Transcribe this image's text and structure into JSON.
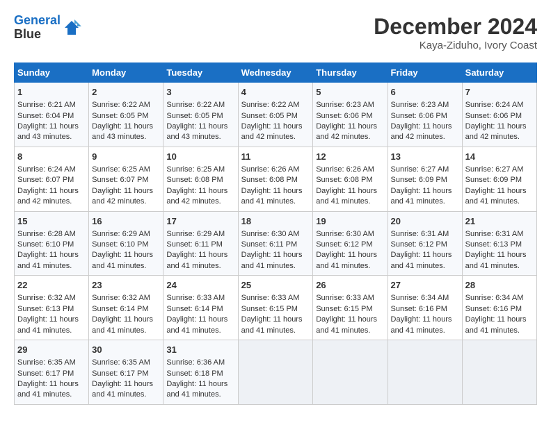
{
  "header": {
    "logo_line1": "General",
    "logo_line2": "Blue",
    "title": "December 2024",
    "subtitle": "Kaya-Ziduho, Ivory Coast"
  },
  "days_of_week": [
    "Sunday",
    "Monday",
    "Tuesday",
    "Wednesday",
    "Thursday",
    "Friday",
    "Saturday"
  ],
  "weeks": [
    [
      {
        "day": "1",
        "lines": [
          "Sunrise: 6:21 AM",
          "Sunset: 6:04 PM",
          "Daylight: 11 hours",
          "and 43 minutes."
        ]
      },
      {
        "day": "2",
        "lines": [
          "Sunrise: 6:22 AM",
          "Sunset: 6:05 PM",
          "Daylight: 11 hours",
          "and 43 minutes."
        ]
      },
      {
        "day": "3",
        "lines": [
          "Sunrise: 6:22 AM",
          "Sunset: 6:05 PM",
          "Daylight: 11 hours",
          "and 43 minutes."
        ]
      },
      {
        "day": "4",
        "lines": [
          "Sunrise: 6:22 AM",
          "Sunset: 6:05 PM",
          "Daylight: 11 hours",
          "and 42 minutes."
        ]
      },
      {
        "day": "5",
        "lines": [
          "Sunrise: 6:23 AM",
          "Sunset: 6:06 PM",
          "Daylight: 11 hours",
          "and 42 minutes."
        ]
      },
      {
        "day": "6",
        "lines": [
          "Sunrise: 6:23 AM",
          "Sunset: 6:06 PM",
          "Daylight: 11 hours",
          "and 42 minutes."
        ]
      },
      {
        "day": "7",
        "lines": [
          "Sunrise: 6:24 AM",
          "Sunset: 6:06 PM",
          "Daylight: 11 hours",
          "and 42 minutes."
        ]
      }
    ],
    [
      {
        "day": "8",
        "lines": [
          "Sunrise: 6:24 AM",
          "Sunset: 6:07 PM",
          "Daylight: 11 hours",
          "and 42 minutes."
        ]
      },
      {
        "day": "9",
        "lines": [
          "Sunrise: 6:25 AM",
          "Sunset: 6:07 PM",
          "Daylight: 11 hours",
          "and 42 minutes."
        ]
      },
      {
        "day": "10",
        "lines": [
          "Sunrise: 6:25 AM",
          "Sunset: 6:08 PM",
          "Daylight: 11 hours",
          "and 42 minutes."
        ]
      },
      {
        "day": "11",
        "lines": [
          "Sunrise: 6:26 AM",
          "Sunset: 6:08 PM",
          "Daylight: 11 hours",
          "and 41 minutes."
        ]
      },
      {
        "day": "12",
        "lines": [
          "Sunrise: 6:26 AM",
          "Sunset: 6:08 PM",
          "Daylight: 11 hours",
          "and 41 minutes."
        ]
      },
      {
        "day": "13",
        "lines": [
          "Sunrise: 6:27 AM",
          "Sunset: 6:09 PM",
          "Daylight: 11 hours",
          "and 41 minutes."
        ]
      },
      {
        "day": "14",
        "lines": [
          "Sunrise: 6:27 AM",
          "Sunset: 6:09 PM",
          "Daylight: 11 hours",
          "and 41 minutes."
        ]
      }
    ],
    [
      {
        "day": "15",
        "lines": [
          "Sunrise: 6:28 AM",
          "Sunset: 6:10 PM",
          "Daylight: 11 hours",
          "and 41 minutes."
        ]
      },
      {
        "day": "16",
        "lines": [
          "Sunrise: 6:29 AM",
          "Sunset: 6:10 PM",
          "Daylight: 11 hours",
          "and 41 minutes."
        ]
      },
      {
        "day": "17",
        "lines": [
          "Sunrise: 6:29 AM",
          "Sunset: 6:11 PM",
          "Daylight: 11 hours",
          "and 41 minutes."
        ]
      },
      {
        "day": "18",
        "lines": [
          "Sunrise: 6:30 AM",
          "Sunset: 6:11 PM",
          "Daylight: 11 hours",
          "and 41 minutes."
        ]
      },
      {
        "day": "19",
        "lines": [
          "Sunrise: 6:30 AM",
          "Sunset: 6:12 PM",
          "Daylight: 11 hours",
          "and 41 minutes."
        ]
      },
      {
        "day": "20",
        "lines": [
          "Sunrise: 6:31 AM",
          "Sunset: 6:12 PM",
          "Daylight: 11 hours",
          "and 41 minutes."
        ]
      },
      {
        "day": "21",
        "lines": [
          "Sunrise: 6:31 AM",
          "Sunset: 6:13 PM",
          "Daylight: 11 hours",
          "and 41 minutes."
        ]
      }
    ],
    [
      {
        "day": "22",
        "lines": [
          "Sunrise: 6:32 AM",
          "Sunset: 6:13 PM",
          "Daylight: 11 hours",
          "and 41 minutes."
        ]
      },
      {
        "day": "23",
        "lines": [
          "Sunrise: 6:32 AM",
          "Sunset: 6:14 PM",
          "Daylight: 11 hours",
          "and 41 minutes."
        ]
      },
      {
        "day": "24",
        "lines": [
          "Sunrise: 6:33 AM",
          "Sunset: 6:14 PM",
          "Daylight: 11 hours",
          "and 41 minutes."
        ]
      },
      {
        "day": "25",
        "lines": [
          "Sunrise: 6:33 AM",
          "Sunset: 6:15 PM",
          "Daylight: 11 hours",
          "and 41 minutes."
        ]
      },
      {
        "day": "26",
        "lines": [
          "Sunrise: 6:33 AM",
          "Sunset: 6:15 PM",
          "Daylight: 11 hours",
          "and 41 minutes."
        ]
      },
      {
        "day": "27",
        "lines": [
          "Sunrise: 6:34 AM",
          "Sunset: 6:16 PM",
          "Daylight: 11 hours",
          "and 41 minutes."
        ]
      },
      {
        "day": "28",
        "lines": [
          "Sunrise: 6:34 AM",
          "Sunset: 6:16 PM",
          "Daylight: 11 hours",
          "and 41 minutes."
        ]
      }
    ],
    [
      {
        "day": "29",
        "lines": [
          "Sunrise: 6:35 AM",
          "Sunset: 6:17 PM",
          "Daylight: 11 hours",
          "and 41 minutes."
        ]
      },
      {
        "day": "30",
        "lines": [
          "Sunrise: 6:35 AM",
          "Sunset: 6:17 PM",
          "Daylight: 11 hours",
          "and 41 minutes."
        ]
      },
      {
        "day": "31",
        "lines": [
          "Sunrise: 6:36 AM",
          "Sunset: 6:18 PM",
          "Daylight: 11 hours",
          "and 41 minutes."
        ]
      },
      null,
      null,
      null,
      null
    ]
  ],
  "colors": {
    "header_bg": "#1a6fc4",
    "header_text": "#ffffff",
    "odd_row": "#f7f9fc",
    "even_row": "#ffffff",
    "empty_cell": "#eef1f5"
  }
}
